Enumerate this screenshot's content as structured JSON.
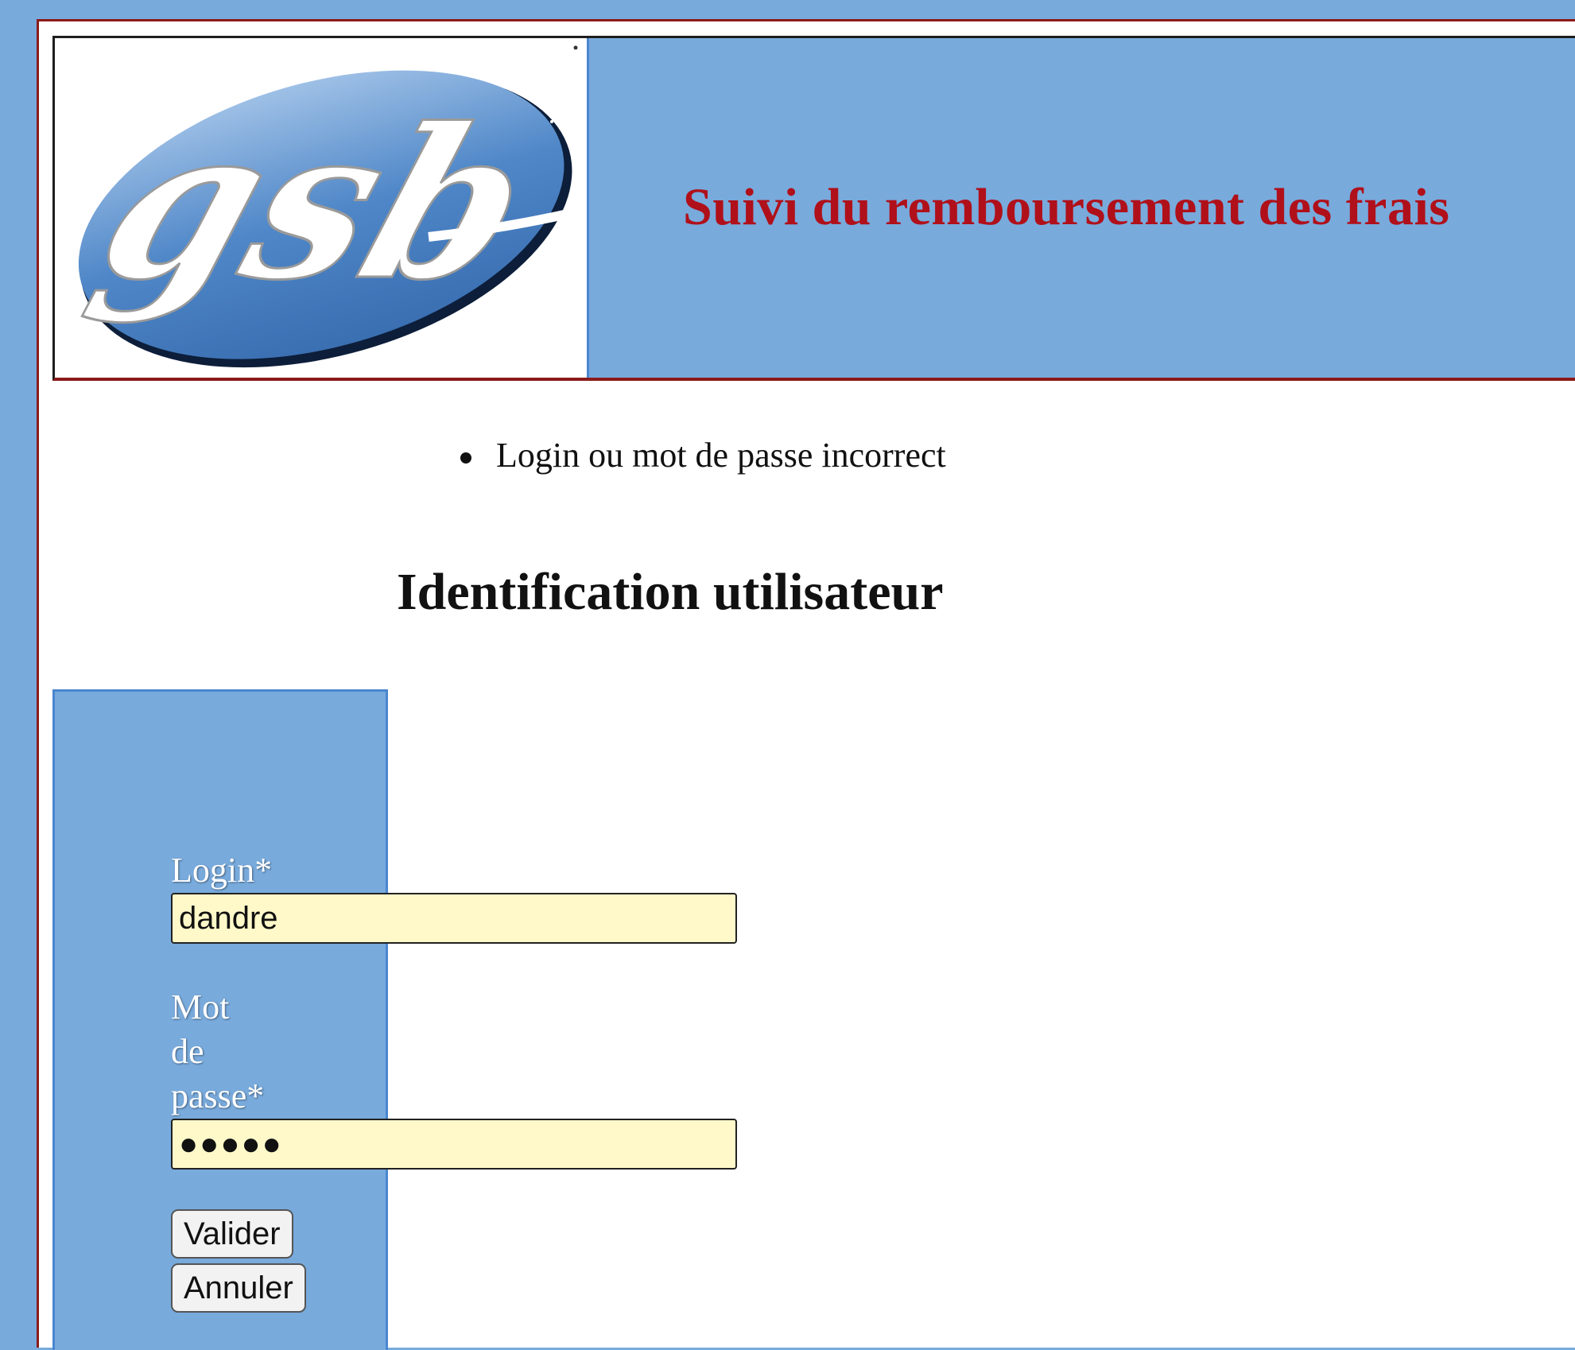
{
  "header": {
    "logo_text": "gsb",
    "title": "Suivi du remboursement des frais"
  },
  "errors": [
    {
      "message": "Login ou mot de passe incorrect"
    }
  ],
  "page": {
    "title": "Identification utilisateur"
  },
  "login_form": {
    "login_label": "Login*",
    "login_value": "dandre",
    "password_label_line1": "Mot",
    "password_label_line2": "de",
    "password_label_line3": "passe*",
    "password_mask": "●●●●●",
    "submit_label": "Valider",
    "reset_label": "Annuler"
  },
  "colors": {
    "background_blue": "#78aadc",
    "title_red": "#b0101a",
    "input_yellow": "#fff9c9",
    "frame_border": "#8a1a1a"
  }
}
